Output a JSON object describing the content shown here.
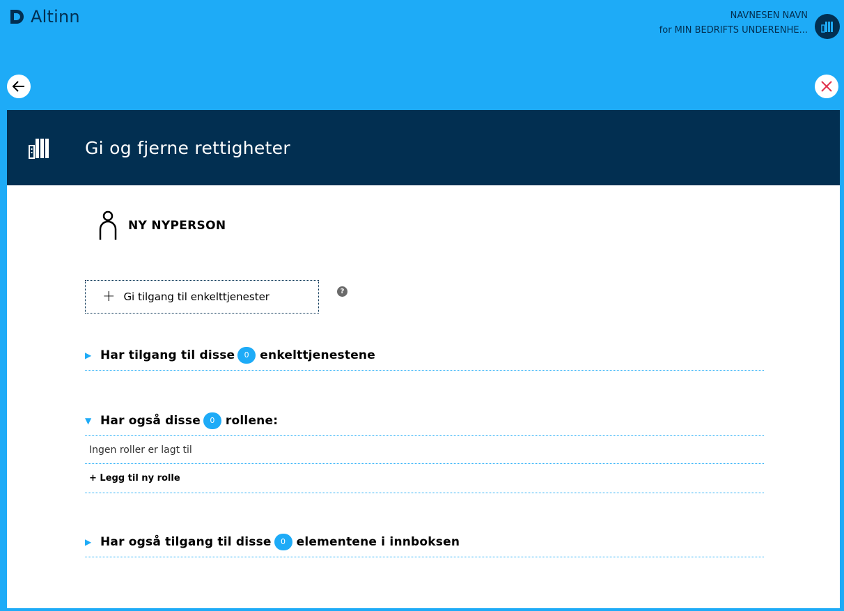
{
  "app": {
    "name": "Altinn"
  },
  "user": {
    "name": "NAVNESEN NAVN",
    "org": "for MIN BEDRIFTS UNDERENHE..."
  },
  "header": {
    "title": "Gi og fjerne rettigheter"
  },
  "person": {
    "name": "NY NYPERSON"
  },
  "actions": {
    "add_service_label": "Gi tilgang til enkelttjenester",
    "help_symbol": "?"
  },
  "sections": [
    {
      "prefix": "Har tilgang til disse",
      "count": "0",
      "suffix": "enkelttjenestene",
      "expanded": false
    },
    {
      "prefix": "Har også disse",
      "count": "0",
      "suffix": "rollene:",
      "expanded": true,
      "empty_text": "Ingen roller er lagt til",
      "add_label": "+ Legg til ny rolle"
    },
    {
      "prefix": "Har også tilgang til disse",
      "count": "0",
      "suffix": "elementene i innboksen",
      "expanded": false
    }
  ],
  "colors": {
    "background": "#1eabf7",
    "header": "#022f51",
    "accent": "#1eabf7",
    "close": "#e02e49"
  },
  "icons": {
    "logo": "altinn-logo-icon",
    "avatar": "building-icon",
    "back": "arrow-left-icon",
    "close": "close-icon",
    "header": "building-icon",
    "person": "person-icon",
    "plus": "plus-icon",
    "help": "help-icon"
  }
}
